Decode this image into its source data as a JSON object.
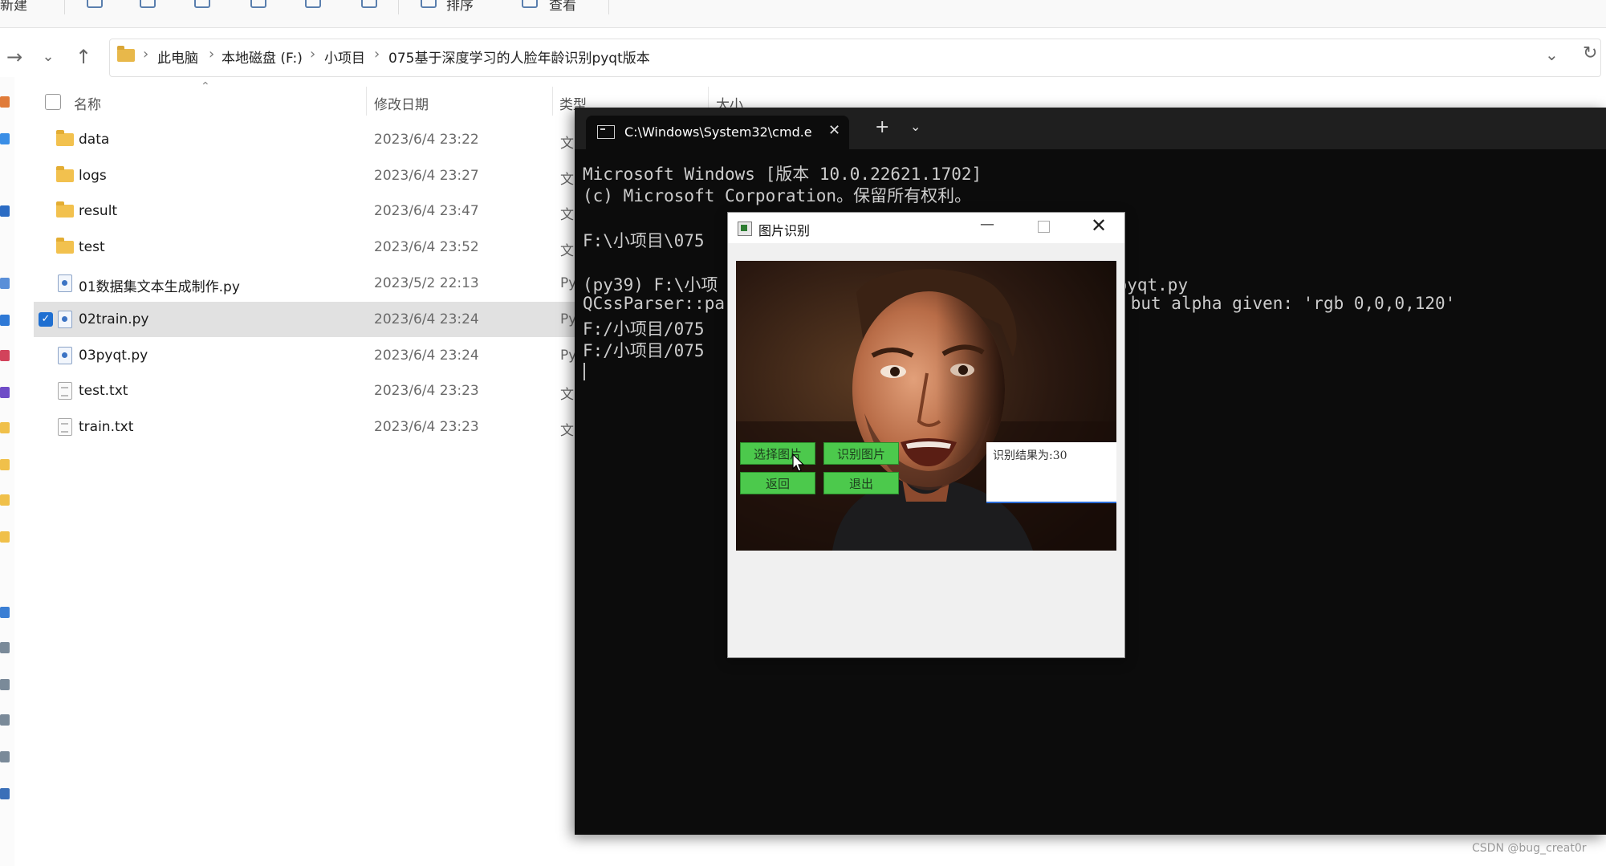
{
  "toolbar": {
    "new_label": "新建",
    "sort_label": "排序",
    "view_label": "查看"
  },
  "address": {
    "crumbs": [
      "此电脑",
      "本地磁盘 (F:)",
      "小项目",
      "075基于深度学习的人脸年龄识别pyqt版本"
    ]
  },
  "columns": {
    "name": "名称",
    "date": "修改日期",
    "type": "类型",
    "size": "大小"
  },
  "files": [
    {
      "name": "data",
      "date": "2023/6/4 23:22",
      "type": "文",
      "kind": "folder",
      "selected": false
    },
    {
      "name": "logs",
      "date": "2023/6/4 23:27",
      "type": "文",
      "kind": "folder",
      "selected": false
    },
    {
      "name": "result",
      "date": "2023/6/4 23:47",
      "type": "文",
      "kind": "folder",
      "selected": false
    },
    {
      "name": "test",
      "date": "2023/6/4 23:52",
      "type": "文",
      "kind": "folder",
      "selected": false
    },
    {
      "name": "01数据集文本生成制作.py",
      "date": "2023/5/2 22:13",
      "type": "Py",
      "kind": "py",
      "selected": false
    },
    {
      "name": "02train.py",
      "date": "2023/6/4 23:24",
      "type": "Py",
      "kind": "py",
      "selected": true
    },
    {
      "name": "03pyqt.py",
      "date": "2023/6/4 23:24",
      "type": "Py",
      "kind": "py",
      "selected": false
    },
    {
      "name": "test.txt",
      "date": "2023/6/4 23:23",
      "type": "文",
      "kind": "txt",
      "selected": false
    },
    {
      "name": "train.txt",
      "date": "2023/6/4 23:23",
      "type": "文",
      "kind": "txt",
      "selected": false
    }
  ],
  "cmd": {
    "tab_title": "C:\\Windows\\System32\\cmd.e",
    "lines": [
      "Microsoft Windows [版本 10.0.22621.1702]",
      "(c) Microsoft Corporation。保留所有权利。",
      "",
      "F:\\小项目\\075                          tivate py39",
      "",
      "(py39) F:\\小项                          版本>python 03pyqt.py",
      "QCssParser::pa                          t alpha value but alpha given: 'rgb 0,0,0,120'",
      "F:/小项目/075                           st/000021.jpg",
      "F:/小项目/075                           st/000177.jpg"
    ]
  },
  "dialog": {
    "title": "图片识别",
    "buttons": {
      "select": "选择图片",
      "recognize": "识别图片",
      "back": "返回",
      "exit": "退出"
    },
    "result": "识别结果为:30"
  },
  "watermark": "CSDN @bug_creat0r",
  "colors": {
    "accent": "#1f6fd1",
    "button_green": "#4cc94c",
    "console_bg": "#0c0c0c",
    "console_text": "#cccccc"
  }
}
